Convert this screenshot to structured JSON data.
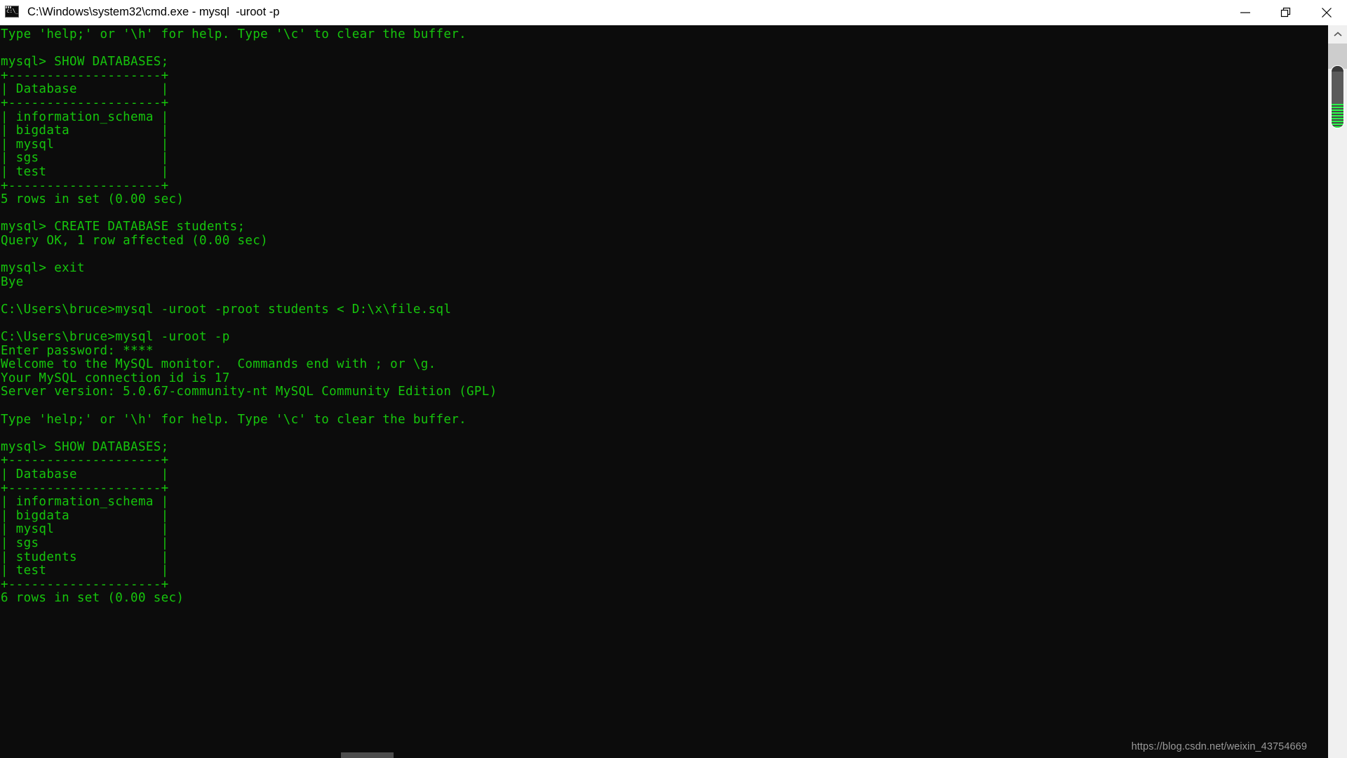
{
  "window": {
    "title": "C:\\Windows\\system32\\cmd.exe - mysql  -uroot -p",
    "icon": "cmd-console-icon",
    "controls": {
      "minimize_label": "Minimize",
      "restore_label": "Restore",
      "close_label": "Close"
    },
    "colors": {
      "titlebar_bg": "#ffffff",
      "titlebar_fg": "#000000",
      "terminal_bg": "#0c0c0c",
      "terminal_fg": "#16c60c",
      "scrollbar_track": "#f0f0f0",
      "scrollbar_thumb": "#5b5b5b",
      "scrollbar_stripe": "#2aff4a",
      "watermark_fg": "#9a9a9a"
    }
  },
  "scrollbar": {
    "up_arrow_icon": "chevron-up-icon",
    "vertical_present": true,
    "horizontal_present": true
  },
  "watermark": {
    "text": "https://blog.csdn.net/weixin_43754669"
  },
  "terminal": {
    "content": "Type 'help;' or '\\h' for help. Type '\\c' to clear the buffer.\n\nmysql> SHOW DATABASES;\n+--------------------+\n| Database           |\n+--------------------+\n| information_schema |\n| bigdata            |\n| mysql              |\n| sgs                |\n| test               |\n+--------------------+\n5 rows in set (0.00 sec)\n\nmysql> CREATE DATABASE students;\nQuery OK, 1 row affected (0.00 sec)\n\nmysql> exit\nBye\n\nC:\\Users\\bruce>mysql -uroot -proot students < D:\\x\\file.sql\n\nC:\\Users\\bruce>mysql -uroot -p\nEnter password: ****\nWelcome to the MySQL monitor.  Commands end with ; or \\g.\nYour MySQL connection id is 17\nServer version: 5.0.67-community-nt MySQL Community Edition (GPL)\n\nType 'help;' or '\\h' for help. Type '\\c' to clear the buffer.\n\nmysql> SHOW DATABASES;\n+--------------------+\n| Database           |\n+--------------------+\n| information_schema |\n| bigdata            |\n| mysql              |\n| sgs                |\n| students           |\n| test               |\n+--------------------+\n6 rows in set (0.00 sec)",
    "lines": [
      "Type 'help;' or '\\h' for help. Type '\\c' to clear the buffer.",
      "",
      "mysql> SHOW DATABASES;",
      "+--------------------+",
      "| Database           |",
      "+--------------------+",
      "| information_schema |",
      "| bigdata            |",
      "| mysql              |",
      "| sgs                |",
      "| test               |",
      "+--------------------+",
      "5 rows in set (0.00 sec)",
      "",
      "mysql> CREATE DATABASE students;",
      "Query OK, 1 row affected (0.00 sec)",
      "",
      "mysql> exit",
      "Bye",
      "",
      "C:\\Users\\bruce>mysql -uroot -proot students < D:\\x\\file.sql",
      "",
      "C:\\Users\\bruce>mysql -uroot -p",
      "Enter password: ****",
      "Welcome to the MySQL monitor.  Commands end with ; or \\g.",
      "Your MySQL connection id is 17",
      "Server version: 5.0.67-community-nt MySQL Community Edition (GPL)",
      "",
      "Type 'help;' or '\\h' for help. Type '\\c' to clear the buffer.",
      "",
      "mysql> SHOW DATABASES;",
      "+--------------------+",
      "| Database           |",
      "+--------------------+",
      "| information_schema |",
      "| bigdata            |",
      "| mysql              |",
      "| sgs                |",
      "| students           |",
      "| test               |",
      "+--------------------+",
      "6 rows in set (0.00 sec)"
    ],
    "prompt_symbol": "mysql>",
    "shell_prompt": "C:\\Users\\bruce>",
    "commands": [
      "SHOW DATABASES;",
      "CREATE DATABASE students;",
      "exit",
      "mysql -uroot -proot students < D:\\x\\file.sql",
      "mysql -uroot -p",
      "SHOW DATABASES;"
    ],
    "databases_before": [
      "information_schema",
      "bigdata",
      "mysql",
      "sgs",
      "test"
    ],
    "databases_after": [
      "information_schema",
      "bigdata",
      "mysql",
      "sgs",
      "students",
      "test"
    ],
    "result_before": "5 rows in set (0.00 sec)",
    "result_after": "6 rows in set (0.00 sec)",
    "create_result": "Query OK, 1 row affected (0.00 sec)",
    "password_masked": "****",
    "connection_id": "17",
    "server_version": "5.0.67-community-nt MySQL Community Edition (GPL)",
    "column_header": "Database"
  }
}
